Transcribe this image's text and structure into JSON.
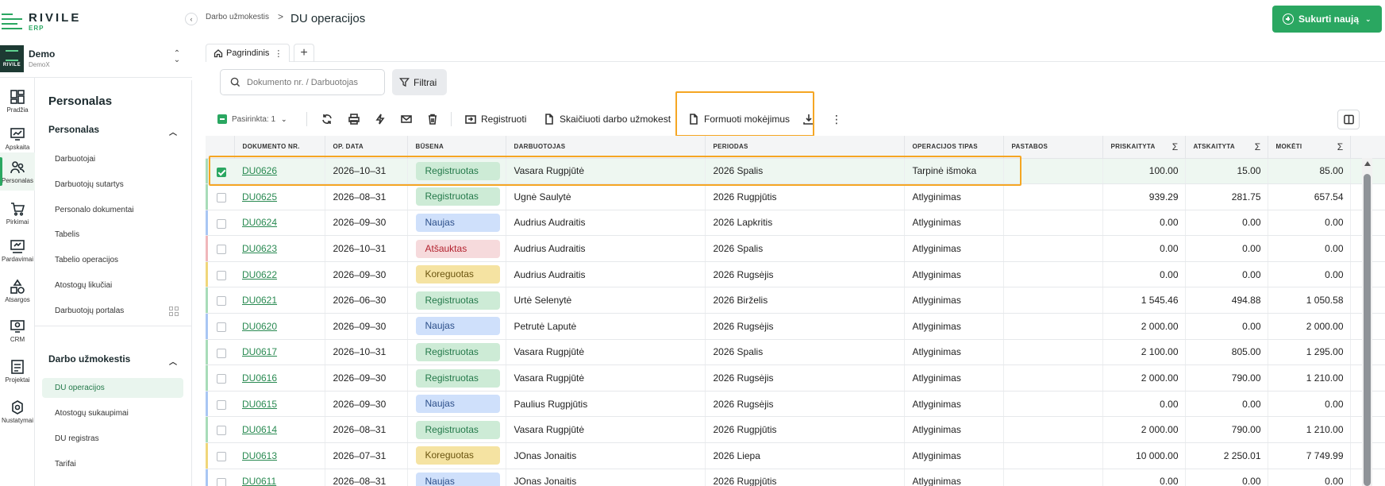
{
  "brand": {
    "name": "RIVILE",
    "sub": "ERP"
  },
  "company": {
    "name": "Demo",
    "code": "DemoX",
    "logo_text": "RIVILE"
  },
  "rail": [
    {
      "label": "Pradžia",
      "icon": "dashboard-icon"
    },
    {
      "label": "Apskaita",
      "icon": "chart-monitor-icon"
    },
    {
      "label": "Personalas",
      "icon": "people-icon"
    },
    {
      "label": "Pirkimai",
      "icon": "cart-icon"
    },
    {
      "label": "Pardavimai",
      "icon": "sales-icon"
    },
    {
      "label": "Atsargos",
      "icon": "shapes-icon"
    },
    {
      "label": "CRM",
      "icon": "crm-icon"
    },
    {
      "label": "Projektai",
      "icon": "projects-icon"
    },
    {
      "label": "Nustatymai",
      "icon": "gear-icon"
    }
  ],
  "submenu": {
    "title": "Personalas",
    "section1": "Personalas",
    "items1": [
      "Darbuotojai",
      "Darbuotojų sutartys",
      "Personalo dokumentai",
      "Tabelis",
      "Tabelio operacijos",
      "Atostogų likučiai",
      "Darbuotojų portalas"
    ],
    "section2": "Darbo užmokestis",
    "items2": [
      "DU operacijos",
      "Atostogų sukaupimai",
      "DU registras",
      "Tarifai"
    ]
  },
  "header": {
    "breadcrumb": "Darbo užmokestis",
    "separator": ">",
    "title": "DU operacijos",
    "create_label": "Sukurti naują"
  },
  "tabs": {
    "main": "Pagrindinis",
    "add": "+"
  },
  "search": {
    "placeholder": "Dokumento nr. / Darbuotojas",
    "value": ""
  },
  "filter_label": "Filtrai",
  "toolbar": {
    "selected": "Pasirinkta: 1",
    "registruoti": "Registruoti",
    "skaiciuoti": "Skaičiuoti darbo užmokestį",
    "formuoti": "Formuoti mokėjimus"
  },
  "columns": [
    "DOKUMENTO NR.",
    "OP. DATA",
    "BŪSENA",
    "DARBUOTOJAS",
    "PERIODAS",
    "OPERACIJOS TIPAS",
    "PASTABOS",
    "PRISKAITYTA",
    "ATSKAITYTA",
    "MOKĖTI"
  ],
  "sigma": "Σ",
  "status_colors": {
    "Registruotas": {
      "bg": "#cdebd6",
      "fg": "#24794a",
      "stripe": "#a8dcb9"
    },
    "Naujas": {
      "bg": "#cfe0fb",
      "fg": "#2c4f8a",
      "stripe": "#a9c6f3"
    },
    "Atšauktas": {
      "bg": "#f6dadc",
      "fg": "#b3232f",
      "stripe": "#f0b7bb"
    },
    "Koreguotas": {
      "bg": "#f5e3a2",
      "fg": "#6b5510",
      "stripe": "#f0d67a"
    }
  },
  "rows": [
    {
      "doc": "DU0626",
      "date": "2026–10–31",
      "status": "Registruotas",
      "employee": "Vasara Rugpjūtė",
      "period": "2026 Spalis",
      "type": "Tarpinė išmoka",
      "notes": "",
      "accrued": "100.00",
      "deducted": "15.00",
      "pay": "85.00",
      "selected": true
    },
    {
      "doc": "DU0625",
      "date": "2026–08–31",
      "status": "Registruotas",
      "employee": "Ugnė Saulytė",
      "period": "2026 Rugpjūtis",
      "type": "Atlyginimas",
      "notes": "",
      "accrued": "939.29",
      "deducted": "281.75",
      "pay": "657.54",
      "selected": false
    },
    {
      "doc": "DU0624",
      "date": "2026–09–30",
      "status": "Naujas",
      "employee": "Audrius Audraitis",
      "period": "2026 Lapkritis",
      "type": "Atlyginimas",
      "notes": "",
      "accrued": "0.00",
      "deducted": "0.00",
      "pay": "0.00",
      "selected": false
    },
    {
      "doc": "DU0623",
      "date": "2026–10–31",
      "status": "Atšauktas",
      "employee": "Audrius Audraitis",
      "period": "2026 Spalis",
      "type": "Atlyginimas",
      "notes": "",
      "accrued": "0.00",
      "deducted": "0.00",
      "pay": "0.00",
      "selected": false
    },
    {
      "doc": "DU0622",
      "date": "2026–09–30",
      "status": "Koreguotas",
      "employee": "Audrius Audraitis",
      "period": "2026 Rugsėjis",
      "type": "Atlyginimas",
      "notes": "",
      "accrued": "0.00",
      "deducted": "0.00",
      "pay": "0.00",
      "selected": false
    },
    {
      "doc": "DU0621",
      "date": "2026–06–30",
      "status": "Registruotas",
      "employee": "Urtė Selenytė",
      "period": "2026 Birželis",
      "type": "Atlyginimas",
      "notes": "",
      "accrued": "1 545.46",
      "deducted": "494.88",
      "pay": "1 050.58",
      "selected": false
    },
    {
      "doc": "DU0620",
      "date": "2026–09–30",
      "status": "Naujas",
      "employee": "Petrutė Laputė",
      "period": "2026 Rugsėjis",
      "type": "Atlyginimas",
      "notes": "",
      "accrued": "2 000.00",
      "deducted": "0.00",
      "pay": "2 000.00",
      "selected": false
    },
    {
      "doc": "DU0617",
      "date": "2026–10–31",
      "status": "Registruotas",
      "employee": "Vasara Rugpjūtė",
      "period": "2026 Spalis",
      "type": "Atlyginimas",
      "notes": "",
      "accrued": "2 100.00",
      "deducted": "805.00",
      "pay": "1 295.00",
      "selected": false
    },
    {
      "doc": "DU0616",
      "date": "2026–09–30",
      "status": "Registruotas",
      "employee": "Vasara Rugpjūtė",
      "period": "2026 Rugsėjis",
      "type": "Atlyginimas",
      "notes": "",
      "accrued": "2 000.00",
      "deducted": "790.00",
      "pay": "1 210.00",
      "selected": false
    },
    {
      "doc": "DU0615",
      "date": "2026–09–30",
      "status": "Naujas",
      "employee": "Paulius Rugpjūtis",
      "period": "2026 Rugsėjis",
      "type": "Atlyginimas",
      "notes": "",
      "accrued": "0.00",
      "deducted": "0.00",
      "pay": "0.00",
      "selected": false
    },
    {
      "doc": "DU0614",
      "date": "2026–08–31",
      "status": "Registruotas",
      "employee": "Vasara Rugpjūtė",
      "period": "2026 Rugpjūtis",
      "type": "Atlyginimas",
      "notes": "",
      "accrued": "2 000.00",
      "deducted": "790.00",
      "pay": "1 210.00",
      "selected": false
    },
    {
      "doc": "DU0613",
      "date": "2026–07–31",
      "status": "Koreguotas",
      "employee": "JOnas Jonaitis",
      "period": "2026 Liepa",
      "type": "Atlyginimas",
      "notes": "",
      "accrued": "10 000.00",
      "deducted": "2 250.01",
      "pay": "7 749.99",
      "selected": false
    },
    {
      "doc": "DU0611",
      "date": "2026–08–31",
      "status": "Naujas",
      "employee": "JOnas Jonaitis",
      "period": "2026 Rugpjūtis",
      "type": "Atlyginimas",
      "notes": "",
      "accrued": "0.00",
      "deducted": "0.00",
      "pay": "0.00",
      "selected": false
    }
  ]
}
